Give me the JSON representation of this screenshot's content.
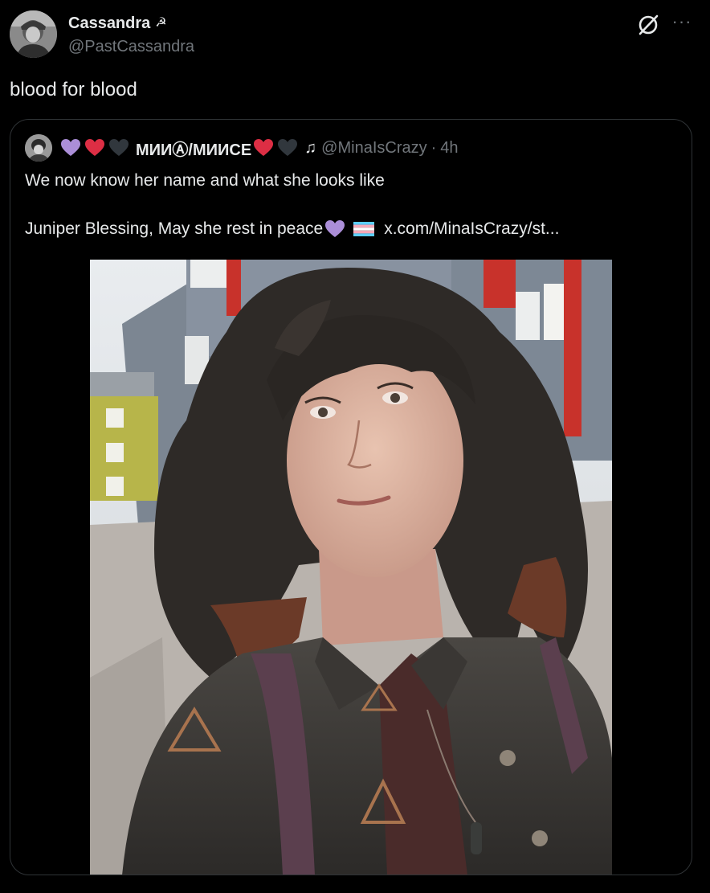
{
  "author": {
    "name": "Cassandra",
    "name_glyph": "☭",
    "handle": "@PastCassandra"
  },
  "tweet": {
    "text": "blood for blood"
  },
  "header_icons": {
    "grok": "grok-icon",
    "more": "more-icon",
    "more_glyph": "···"
  },
  "quote": {
    "display_name": "МИИⒶ/МИИСЕ",
    "name_glyph": "♫",
    "handle": "@MinaIsCrazy",
    "separator": "·",
    "time": "4h",
    "line1": "We now know her name and what she looks like",
    "line2_text": "Juniper Blessing, May she rest in peace",
    "line2_link": "x.com/MinaIsCrazy/st...",
    "hearts": [
      "purple",
      "red",
      "black"
    ],
    "name_hearts": [
      "red",
      "black"
    ]
  },
  "colors": {
    "background": "#000000",
    "text": "#e7e9ea",
    "secondary": "#71767b",
    "border": "#2f3336",
    "heart_purple": "#ab8ed8",
    "heart_red": "#dd2e44",
    "heart_black": "#31373d"
  }
}
